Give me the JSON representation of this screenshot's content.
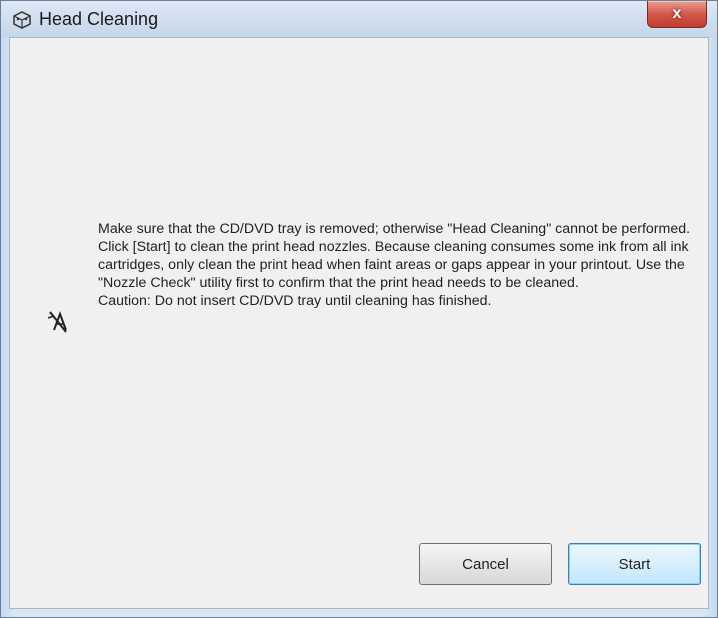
{
  "window": {
    "title": "Head Cleaning",
    "close_label": "x",
    "app_icon": "printer-head-icon"
  },
  "message": {
    "lines": [
      "Make sure that the CD/DVD tray is removed; otherwise \"Head Cleaning\" cannot be performed. Click [Start] to clean the print head nozzles. Because cleaning consumes some ink from all ink cartridges, only clean the print head when faint areas or gaps appear in your printout. Use the \"Nozzle Check\" utility first to confirm that the print head needs to be cleaned.",
      "Caution: Do not insert CD/DVD tray until cleaning has finished."
    ],
    "icon": "head-cleaning-icon"
  },
  "buttons": {
    "cancel_label": "Cancel",
    "start_label": "Start"
  },
  "colors": {
    "close_button": "#d3574a",
    "start_border": "#3c7fb1"
  }
}
